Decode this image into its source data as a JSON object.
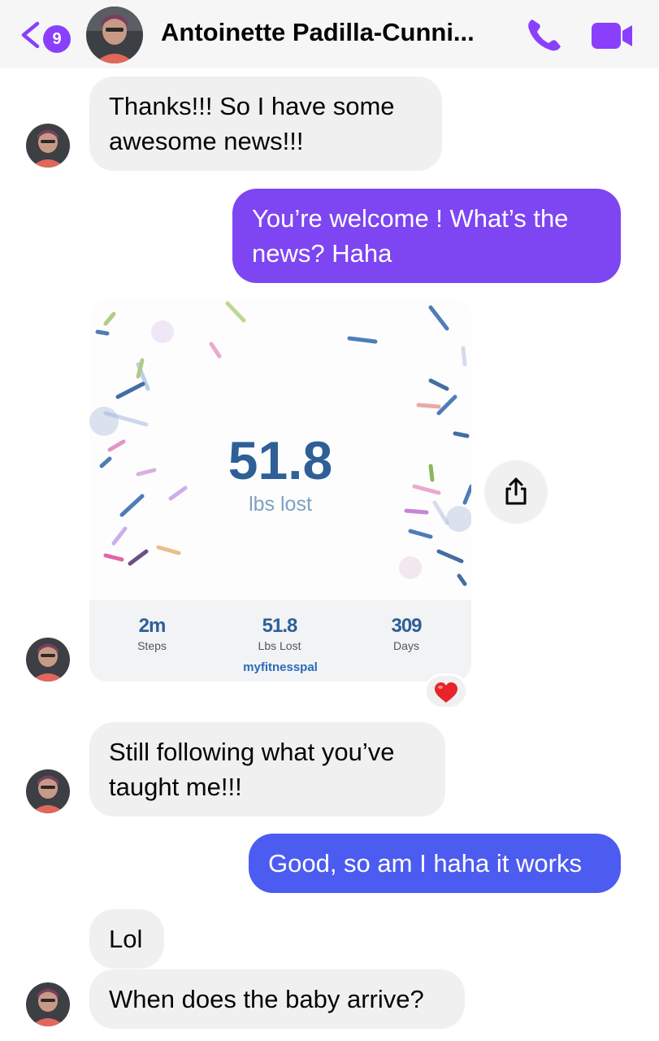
{
  "header": {
    "back_count": "9",
    "contact_name": "Antoinette Padilla-Cunni...",
    "accent_color": "#8a3ffc"
  },
  "messages": [
    {
      "from": "contact",
      "text_lines": [
        "Thanks!!!  So I have some",
        "awesome news!!!"
      ]
    },
    {
      "from": "me",
      "text_lines": [
        "You’re welcome ! What’s the",
        "news? Haha"
      ]
    },
    {
      "from": "contact",
      "type": "shared_card",
      "card": {
        "big_value": "51.8",
        "big_label": "lbs lost",
        "stats": [
          {
            "value": "2m",
            "label": "Steps"
          },
          {
            "value": "51.8",
            "label": "Lbs Lost"
          },
          {
            "value": "309",
            "label": "Days"
          }
        ],
        "brand": "myfitnesspal"
      },
      "reaction": "heart-emoji"
    },
    {
      "from": "contact",
      "text_lines": [
        "Still following what you’ve",
        "taught me!!!"
      ]
    },
    {
      "from": "me",
      "text_lines": [
        "Good, so am I haha it works"
      ]
    },
    {
      "from": "contact",
      "text_lines": [
        "Lol"
      ]
    },
    {
      "from": "contact",
      "text_lines": [
        "When does the baby arrive?"
      ]
    }
  ],
  "colors": {
    "outgoing_purple": "#7e45f2",
    "outgoing_blue": "#4c5cf0",
    "incoming_gray": "#f0f0f0"
  },
  "icons": {
    "back": "chevron-left-icon",
    "call": "phone-icon",
    "video": "video-camera-icon",
    "share": "share-icon",
    "reaction": "heart-emoji"
  }
}
